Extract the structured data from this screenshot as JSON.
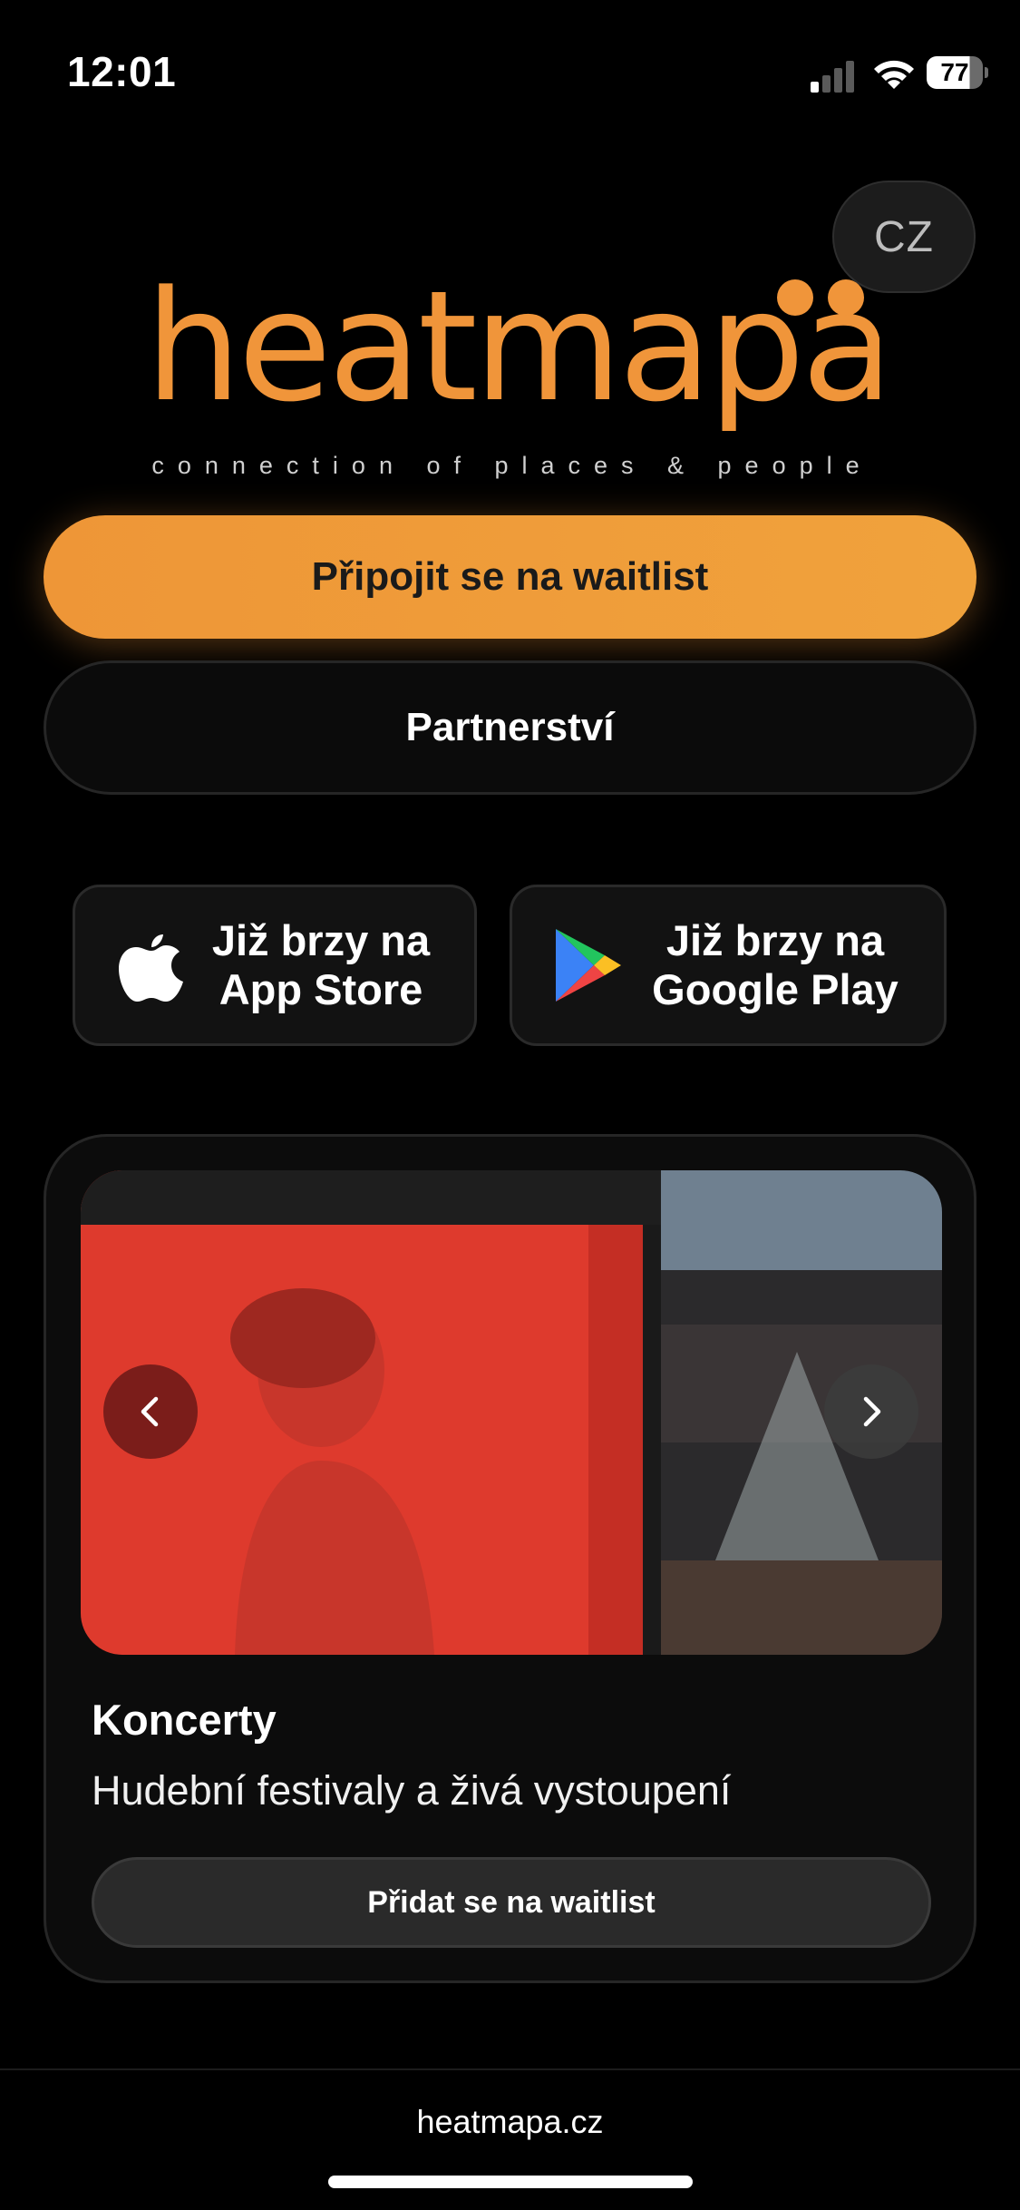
{
  "status_bar": {
    "time": "12:01",
    "battery": "77"
  },
  "language": {
    "label": "CZ"
  },
  "brand": {
    "name": "heatmapa",
    "tagline": "connection of places & people",
    "color": "#f0953a"
  },
  "actions": {
    "primary_label": "Připojit se na waitlist",
    "secondary_label": "Partnerství"
  },
  "stores": {
    "apple": {
      "line1": "Již brzy na",
      "line2": "App Store"
    },
    "google": {
      "line1": "Již brzy na",
      "line2": "Google Play"
    }
  },
  "card": {
    "title": "Koncerty",
    "description": "Hudební festivaly a živá vystoupení",
    "button_label": "Přidat se na waitlist"
  },
  "footer": {
    "url": "heatmapa.cz"
  }
}
